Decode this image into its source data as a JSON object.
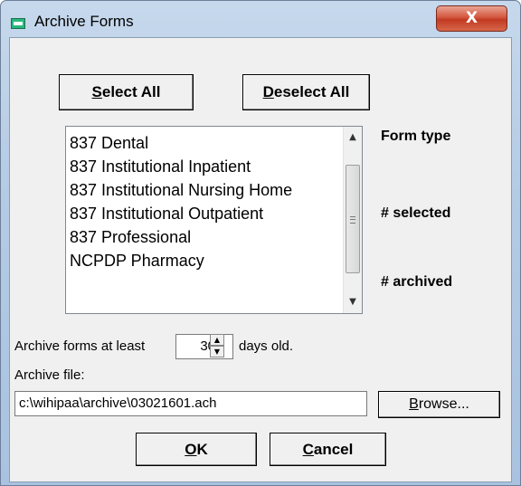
{
  "window": {
    "title": "Archive Forms",
    "close_label": "X"
  },
  "buttons": {
    "select_all": {
      "accel": "S",
      "rest": "elect All"
    },
    "deselect_all": {
      "accel": "D",
      "rest": "eselect All"
    },
    "browse": {
      "accel": "B",
      "rest": "rowse..."
    },
    "ok": {
      "accel": "O",
      "rest": "K"
    },
    "cancel": {
      "accel": "C",
      "rest": "ancel"
    }
  },
  "form_types": [
    "837 Dental",
    "837 Institutional Inpatient",
    "837 Institutional Nursing Home",
    "837 Institutional Outpatient",
    "837 Professional",
    "NCPDP Pharmacy"
  ],
  "side_labels": {
    "form_type": "Form type",
    "selected": "# selected",
    "archived": "# archived"
  },
  "age": {
    "prefix": "Archive forms at least",
    "value": "30",
    "suffix": "days old."
  },
  "archive_file": {
    "label": "Archive file:",
    "value": "c:\\wihipaa\\archive\\03021601.ach"
  },
  "icons": {
    "title_icon": "window-icon",
    "scroll_up": "▲",
    "scroll_down": "▼",
    "spin_up": "▲",
    "spin_down": "▼"
  }
}
